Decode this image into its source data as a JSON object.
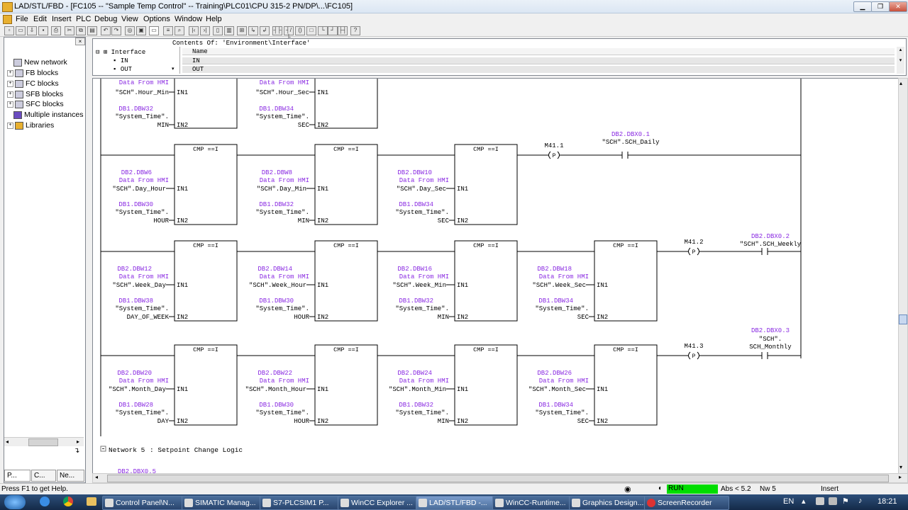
{
  "window": {
    "title": "LAD/STL/FBD  - [FC105 -- \"Sample Temp Control\" -- Training\\PLC01\\CPU 315-2 PN/DP\\...\\FC105]"
  },
  "menu": [
    "File",
    "Edit",
    "Insert",
    "PLC",
    "Debug",
    "View",
    "Options",
    "Window",
    "Help"
  ],
  "tree": [
    {
      "label": "New network",
      "expand": false
    },
    {
      "label": "FB blocks",
      "expand": true
    },
    {
      "label": "FC blocks",
      "expand": true
    },
    {
      "label": "SFB blocks",
      "expand": true
    },
    {
      "label": "SFC blocks",
      "expand": true
    },
    {
      "label": "Multiple instances",
      "expand": false
    },
    {
      "label": "Libraries",
      "expand": true
    }
  ],
  "left_tabs": [
    "P...",
    "C...",
    "Ne..."
  ],
  "interface": {
    "header": "Contents Of: 'Environment\\Interface'",
    "root": "Interface",
    "in": "IN",
    "out": "OUT",
    "col_name": "Name",
    "rows": [
      "IN",
      "OUT"
    ]
  },
  "ladder": {
    "block_label": "CMP ==I",
    "pin1": "IN1",
    "pin2": "IN2",
    "dfh": "Data From HMI",
    "sys": "\"System_Time\".",
    "top_partial": [
      {
        "addr": "",
        "in1": "\"SCH\".Hour_Min",
        "addr2": "DB1.DBW32",
        "in2": "MIN"
      },
      {
        "addr": "",
        "in1": "\"SCH\".Hour_Sec",
        "addr2": "DB1.DBW34",
        "in2": "SEC"
      }
    ],
    "rungs": [
      {
        "cmps": [
          {
            "addr1": "DB2.DBW6",
            "in1": "\"SCH\".Day_Hour",
            "addr2": "DB1.DBW30",
            "in2": "HOUR"
          },
          {
            "addr1": "DB2.DBW8",
            "in1": "\"SCH\".Day_Min",
            "addr2": "DB1.DBW32",
            "in2": "MIN"
          },
          {
            "addr1": "DB2.DBW10",
            "in1": "\"SCH\".Day_Sec",
            "addr2": "DB1.DBW34",
            "in2": "SEC"
          }
        ],
        "pedge": "M41.1",
        "p": "P",
        "coil_addr": "DB2.DBX0.1",
        "coil_name": "\"SCH\".SCH_Daily",
        "coil_name2": ""
      },
      {
        "cmps": [
          {
            "addr1": "DB2.DBW12",
            "in1": "\"SCH\".Week_Day",
            "addr2": "DB1.DBW38",
            "in2": "DAY_OF_WEEK"
          },
          {
            "addr1": "DB2.DBW14",
            "in1": "\"SCH\".Week_Hour",
            "addr2": "DB1.DBW30",
            "in2": "HOUR"
          },
          {
            "addr1": "DB2.DBW16",
            "in1": "\"SCH\".Week_Min",
            "addr2": "DB1.DBW32",
            "in2": "MIN"
          },
          {
            "addr1": "DB2.DBW18",
            "in1": "\"SCH\".Week_Sec",
            "addr2": "DB1.DBW34",
            "in2": "SEC"
          }
        ],
        "pedge": "M41.2",
        "p": "P",
        "coil_addr": "DB2.DBX0.2",
        "coil_name": "\"SCH\".SCH_Weekly",
        "coil_name2": ""
      },
      {
        "cmps": [
          {
            "addr1": "DB2.DBW20",
            "in1": "\"SCH\".Month_Day",
            "addr2": "DB1.DBW28",
            "in2": "DAY"
          },
          {
            "addr1": "DB2.DBW22",
            "in1": "\"SCH\".Month_Hour",
            "addr2": "DB1.DBW30",
            "in2": "HOUR"
          },
          {
            "addr1": "DB2.DBW24",
            "in1": "\"SCH\".Month_Min",
            "addr2": "DB1.DBW32",
            "in2": "MIN"
          },
          {
            "addr1": "DB2.DBW26",
            "in1": "\"SCH\".Month_Sec",
            "addr2": "DB1.DBW34",
            "in2": "SEC"
          }
        ],
        "pedge": "M41.3",
        "p": "P",
        "coil_addr": "DB2.DBX0.3",
        "coil_name": "\"SCH\".",
        "coil_name2": "SCH_Monthly"
      }
    ],
    "network5": {
      "label": "Network 5",
      "title": ": Setpoint Change Logic",
      "addr": "DB2.DBX0.5"
    }
  },
  "status": {
    "help": "Press F1 to get Help.",
    "mode": "RUN",
    "abs": "Abs < 5.2",
    "nw": "Nw 5",
    "insert": "Insert"
  },
  "taskbar": {
    "items": [
      "Control Panel\\N...",
      "SIMATIC Manag...",
      "S7-PLCSIM1  P...",
      "WinCC Explorer ...",
      "LAD/STL/FBD  -...",
      "WinCC-Runtime...",
      "Graphics Design...",
      "ScreenRecorder"
    ],
    "active_index": 4,
    "lang": "EN",
    "time": "18:21"
  }
}
